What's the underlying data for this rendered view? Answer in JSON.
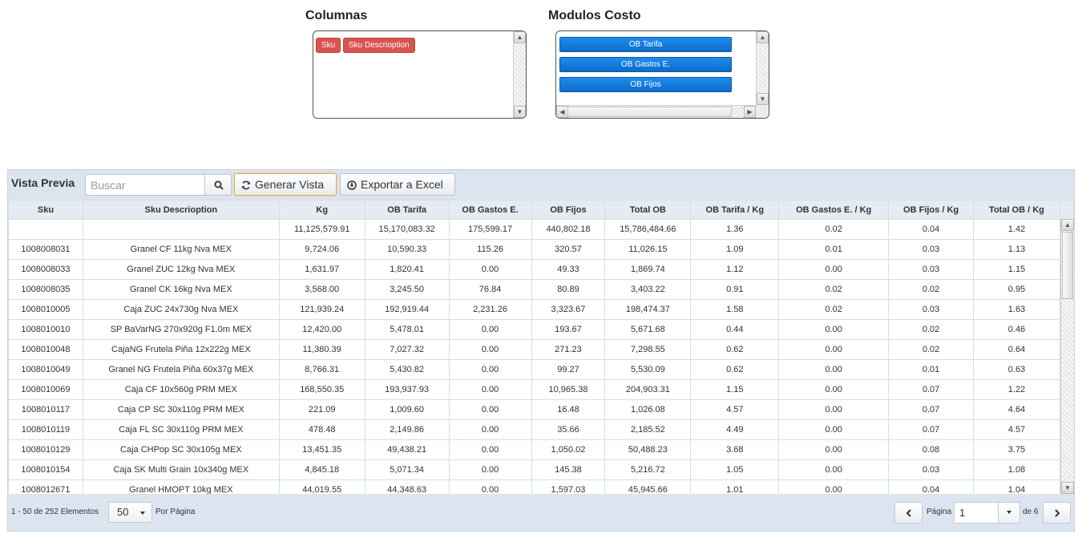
{
  "columns_panel": {
    "title": "Columnas",
    "chips": [
      "Sku",
      "Sku Descrioption"
    ]
  },
  "modules_panel": {
    "title": "Modulos Costo",
    "buttons": [
      "OB Tarifa",
      "OB Gastos E.",
      "OB Fijos"
    ]
  },
  "grid": {
    "title": "Vista Previa",
    "search_placeholder": "Buscar",
    "generate_label": "Generar Vista",
    "export_label": "Exportar a Excel",
    "headers": [
      "Sku",
      "Sku Descrioption",
      "Kg",
      "OB Tarifa",
      "OB Gastos E.",
      "OB Fijos",
      "Total OB",
      "OB Tarifa / Kg",
      "OB Gastos E. / Kg",
      "OB Fijos / Kg",
      "Total OB / Kg"
    ],
    "rows": [
      [
        "",
        "",
        "11,125,579.91",
        "15,170,083.32",
        "175,599.17",
        "440,802.18",
        "15,786,484.66",
        "1.36",
        "0.02",
        "0.04",
        "1.42"
      ],
      [
        "1008008031",
        "Granel CF 11kg Nva MEX",
        "9,724.06",
        "10,590.33",
        "115.26",
        "320.57",
        "11,026.15",
        "1.09",
        "0.01",
        "0.03",
        "1.13"
      ],
      [
        "1008008033",
        "Granel ZUC 12kg Nva MEX",
        "1,631.97",
        "1,820.41",
        "0.00",
        "49.33",
        "1,869.74",
        "1.12",
        "0.00",
        "0.03",
        "1.15"
      ],
      [
        "1008008035",
        "Granel CK 16kg Nva MEX",
        "3,568.00",
        "3,245.50",
        "76.84",
        "80.89",
        "3,403.22",
        "0.91",
        "0.02",
        "0.02",
        "0.95"
      ],
      [
        "1008010005",
        "Caja ZUC 24x730g Nva MEX",
        "121,939.24",
        "192,919.44",
        "2,231.26",
        "3,323.67",
        "198,474.37",
        "1.58",
        "0.02",
        "0.03",
        "1.63"
      ],
      [
        "1008010010",
        "SP BaVarNG 270x920g F1.0m MEX",
        "12,420.00",
        "5,478.01",
        "0.00",
        "193.67",
        "5,671.68",
        "0.44",
        "0.00",
        "0.02",
        "0.46"
      ],
      [
        "1008010048",
        "CajaNG Frutela Piña 12x222g MEX",
        "11,380.39",
        "7,027.32",
        "0.00",
        "271.23",
        "7,298.55",
        "0.62",
        "0.00",
        "0.02",
        "0.64"
      ],
      [
        "1008010049",
        "Granel NG Frutela Piña 60x37g MEX",
        "8,766.31",
        "5,430.82",
        "0.00",
        "99.27",
        "5,530.09",
        "0.62",
        "0.00",
        "0.01",
        "0.63"
      ],
      [
        "1008010069",
        "Caja CF 10x560g PRM MEX",
        "168,550.35",
        "193,937.93",
        "0.00",
        "10,965.38",
        "204,903.31",
        "1.15",
        "0.00",
        "0.07",
        "1.22"
      ],
      [
        "1008010117",
        "Caja CP SC 30x110g PRM MEX",
        "221.09",
        "1,009.60",
        "0.00",
        "16.48",
        "1,026.08",
        "4.57",
        "0.00",
        "0.07",
        "4.64"
      ],
      [
        "1008010119",
        "Caja FL SC 30x110g PRM MEX",
        "478.48",
        "2,149.86",
        "0.00",
        "35.66",
        "2,185.52",
        "4.49",
        "0.00",
        "0.07",
        "4.57"
      ],
      [
        "1008010129",
        "Caja CHPop SC 30x105g MEX",
        "13,451.35",
        "49,438.21",
        "0.00",
        "1,050.02",
        "50,488.23",
        "3.68",
        "0.00",
        "0.08",
        "3.75"
      ],
      [
        "1008010154",
        "Caja SK Multi Grain 10x340g MEX",
        "4,845.18",
        "5,071.34",
        "0.00",
        "145.38",
        "5,216.72",
        "1.05",
        "0.00",
        "0.03",
        "1.08"
      ],
      [
        "1008012671",
        "Granel HMOPT 10kg MEX",
        "44,019.55",
        "44,348.63",
        "0.00",
        "1,597.03",
        "45,945.66",
        "1.01",
        "0.00",
        "0.04",
        "1.04"
      ]
    ]
  },
  "pager": {
    "info": "1 - 50 de 252 Elementos",
    "page_size": "50",
    "per_page_label": "Por Página",
    "pagina_label": "Página",
    "current_page": "1",
    "of_label": "de 6"
  },
  "colors": {
    "chip_red": "#d9534f",
    "module_blue": "#1479dc",
    "grid_bg": "#dbe4ef",
    "header_bg": "#e5ebf2"
  }
}
